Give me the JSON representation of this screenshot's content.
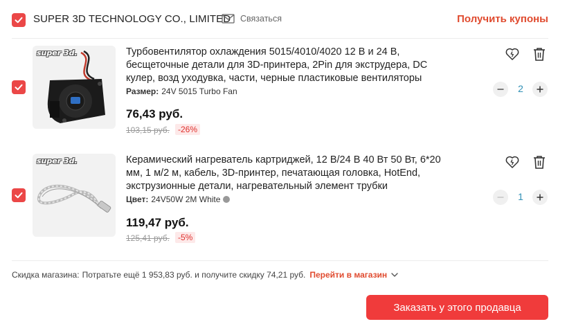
{
  "store": {
    "name": "SUPER 3D TECHNOLOGY CO., LIMITED",
    "contact_label": "Связаться",
    "coupons_label": "Получить купоны"
  },
  "items": [
    {
      "brand_tag": "super 3d.",
      "title": "Турбовентилятор охлаждения 5015/4010/4020 12 В и 24 В, бесщеточные детали для 3D-принтера, 2Pin для экструдера, DC кулер, возд уходувка, части, черные пластиковые вентиляторы",
      "attr_name": "Размер:",
      "attr_value": "24V 5015 Turbo Fan",
      "price": "76,43 руб.",
      "old_price": "103,15 руб.",
      "discount": "-26%",
      "quantity": "2",
      "checked": true
    },
    {
      "brand_tag": "super 3d.",
      "title": "Керамический нагреватель картриджей, 12 В/24 В 40 Вт 50 Вт, 6*20 мм, 1 м/2 м, кабель, 3D-принтер, печатающая головка, HotEnd, экструзионные детали, нагревательный элемент трубки",
      "attr_name": "Цвет:",
      "attr_value": "24V50W 2M White",
      "price": "119,47 руб.",
      "old_price": "125,41 руб.",
      "discount": "-5%",
      "quantity": "1",
      "checked": true
    }
  ],
  "footer": {
    "label": "Скидка магазина:",
    "text": "Потратьте ещё 1 953,83 руб. и получите скидку 74,21 руб.",
    "link": "Перейти в магазин",
    "order_button": "Заказать у этого продавца"
  },
  "colors": {
    "accent": "#f03b3b",
    "link": "#e04b2f",
    "quantity": "#2f8fb5"
  },
  "icons": [
    "check-icon",
    "mail-icon",
    "heart-icon",
    "trash-icon",
    "minus-icon",
    "plus-icon",
    "chevron-down-icon"
  ]
}
